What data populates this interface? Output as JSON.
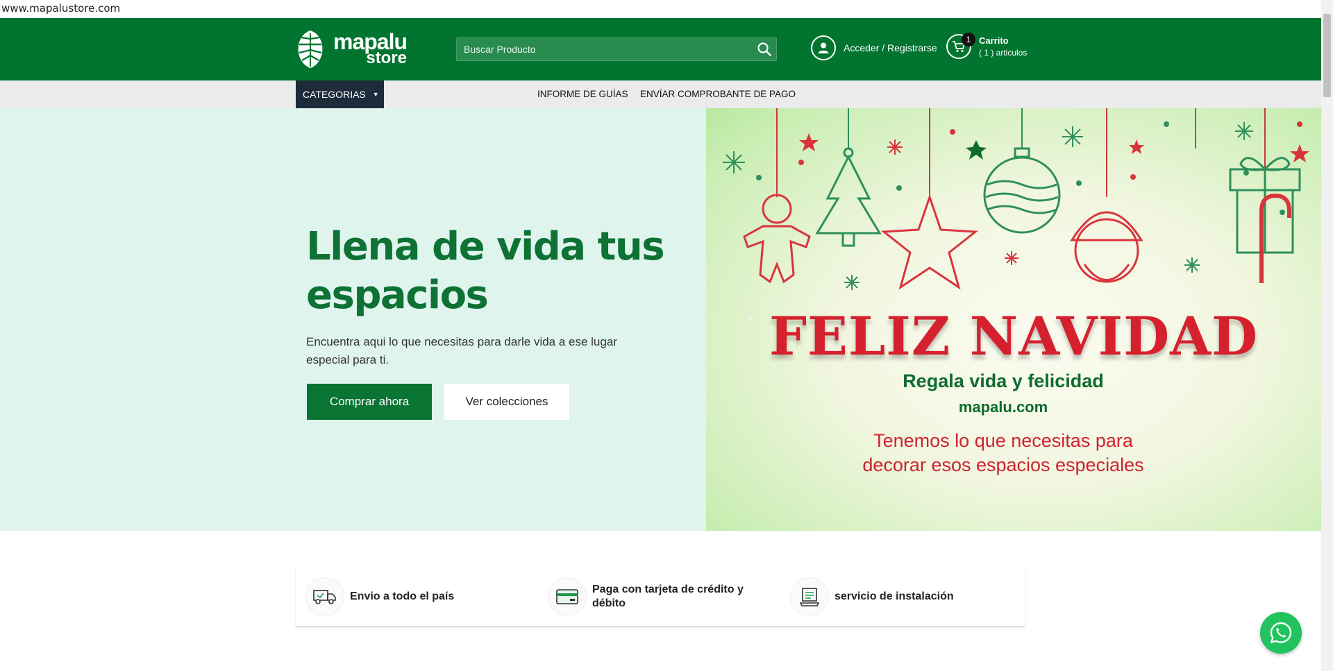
{
  "browser": {
    "url": "www.mapalustore.com"
  },
  "header": {
    "logo_line1": "mapalu",
    "logo_line2": "store",
    "search_placeholder": "Buscar Producto",
    "account_label": "Acceder / Registrarse",
    "cart_count": "1",
    "cart_title": "Carrito",
    "cart_items": "( 1 ) articulos"
  },
  "nav": {
    "categories_label": "CATEGORIAS",
    "links": [
      "INFORME DE GUÍAS",
      "ENVÍAR COMPROBANTE DE PAGO"
    ]
  },
  "hero": {
    "title": "Llena de vida tus espacios",
    "subtitle": "Encuentra aqui lo que necesitas para darle vida a ese lugar especial para ti.",
    "primary_button": "Comprar ahora",
    "secondary_button": "Ver colecciones"
  },
  "banner": {
    "headline": "FELIZ NAVIDAD",
    "tagline": "Regala vida y felicidad",
    "site": "mapalu.com",
    "message": "Tenemos lo que necesitas para decorar esos espacios especiales",
    "prev_arrow": "‹",
    "next_arrow": "›"
  },
  "features": [
    {
      "icon": "delivery-truck-icon",
      "label": "Envio a todo el país"
    },
    {
      "icon": "credit-card-icon",
      "label": "Paga con tarjeta de crédito y débito"
    },
    {
      "icon": "installation-service-icon",
      "label": "servicio de instalación"
    }
  ],
  "colors": {
    "brand_green": "#017530",
    "hero_bg": "#e0f4ee",
    "nav_bg": "#ebebeb",
    "category_bg": "#1d2b3a",
    "whatsapp": "#22c35e"
  }
}
